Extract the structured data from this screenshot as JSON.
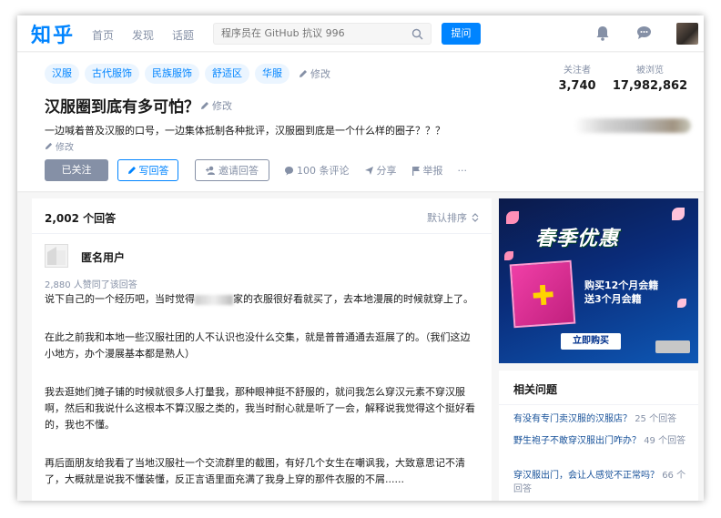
{
  "header": {
    "logo": "知乎",
    "nav": [
      "首页",
      "发现",
      "话题"
    ],
    "search_placeholder": "程序员在 GitHub 抗议 996",
    "ask_label": "提问"
  },
  "question": {
    "tags": [
      "汉服",
      "古代服饰",
      "民族服饰",
      "舒适区",
      "华服"
    ],
    "tags_edit_label": "修改",
    "title": "汉服圈到底有多可怕？",
    "title_edit_label": "修改",
    "detail": "一边喊着普及汉服的口号，一边集体抵制各种批评，汉服圈到底是一个什么样的圈子？？？",
    "detail_edit_label": "修改",
    "followers_label": "关注者",
    "followers_value": "3,740",
    "views_label": "被浏览",
    "views_value": "17,982,862",
    "actions": {
      "followed": "已关注",
      "write_answer": "写回答",
      "invite": "邀请回答",
      "comments": "100 条评论",
      "share": "分享",
      "report": "举报",
      "more": "···"
    }
  },
  "answers": {
    "count_label": "2,002 个回答",
    "sort_label": "默认排序",
    "author": "匿名用户",
    "votes_text": "2,880 人赞同了该回答",
    "p1_a": "说下自己的一个经历吧，当时觉得",
    "p1_b": "家的衣服很好看就买了，去本地漫展的时候就穿上了。",
    "p2": "在此之前我和本地一些汉服社团的人不认识也没什么交集，就是普普通通去逛展了的。（我们这边小地方，办个漫展基本都是熟人）",
    "p3": "我去逛她们摊子铺的时候就很多人打量我，那种眼神挺不舒服的，就问我怎么穿汉元素不穿汉服啊，然后和我说什么这根本不算汉服之类的，我当时耐心就是听了一会，解释说我觉得这个挺好看的，我也不懂。",
    "p4": "再后面朋友给我看了当地汉服社一个交流群里的截图，有好几个女生在嘲讽我，大致意思记不清了，大概就是说我不懂装懂，反正言语里面充满了我身上穿的那件衣服的不屑......"
  },
  "ad": {
    "title": "春季优惠",
    "subtitle_1": "购买12个月会籍",
    "subtitle_2": "送3个月会籍",
    "cta": "立即购买"
  },
  "related": {
    "title": "相关问题",
    "items": [
      {
        "q": "有没有专门卖汉服的汉服店？",
        "count": "25 个回答"
      },
      {
        "q": "穿汉服出门，会让人感觉不正常吗？",
        "count": "66 个回答"
      }
    ],
    "item2_q": "野生袍子不敢穿汉服出门咋办？",
    "item2_count": "49 个回答"
  },
  "colors": {
    "brand": "#0084ff",
    "muted": "#8590a6",
    "link": "#175199",
    "tag_bg": "#ebf5ff"
  }
}
